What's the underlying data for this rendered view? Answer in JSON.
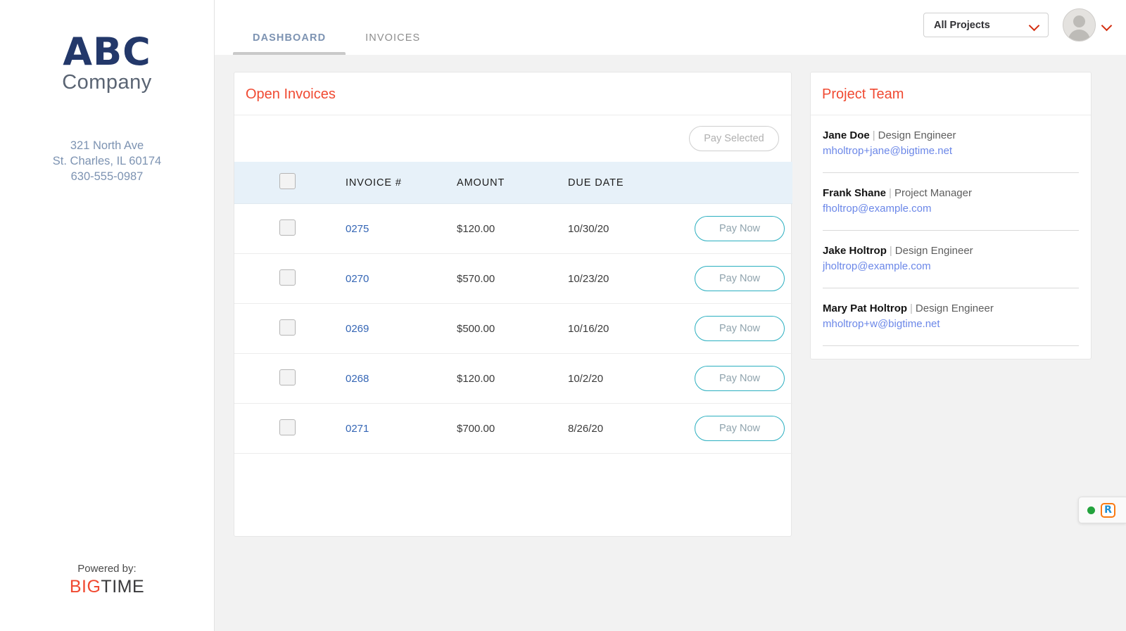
{
  "sidebar": {
    "logo_primary": "ABC",
    "logo_secondary": "Company",
    "address_line1": "321 North Ave",
    "address_line2": "St. Charles, IL 60174",
    "phone": "630-555-0987",
    "powered_label": "Powered by:",
    "powered_brand_first": "BIG",
    "powered_brand_second": "TIME"
  },
  "topbar": {
    "tabs": [
      {
        "label": "DASHBOARD",
        "active": true
      },
      {
        "label": "INVOICES",
        "active": false
      }
    ],
    "project_filter": {
      "selected": "All Projects",
      "icon": "chevron-down-icon"
    },
    "account_menu_icon": "chevron-down-icon",
    "avatar_icon": "user-avatar-icon"
  },
  "invoices_card": {
    "title": "Open Invoices",
    "pay_selected_label": "Pay Selected",
    "pay_selected_enabled": false,
    "columns": [
      "",
      "INVOICE #",
      "AMOUNT",
      "DUE DATE",
      ""
    ],
    "row_action_label": "Pay Now",
    "rows": [
      {
        "checked": false,
        "invoice": "0275",
        "amount": "$120.00",
        "due": "10/30/20",
        "action": "Pay Now"
      },
      {
        "checked": false,
        "invoice": "0270",
        "amount": "$570.00",
        "due": "10/23/20",
        "action": "Pay Now"
      },
      {
        "checked": false,
        "invoice": "0269",
        "amount": "$500.00",
        "due": "10/16/20",
        "action": "Pay Now"
      },
      {
        "checked": false,
        "invoice": "0268",
        "amount": "$120.00",
        "due": "10/2/20",
        "action": "Pay Now"
      },
      {
        "checked": false,
        "invoice": "0271",
        "amount": "$700.00",
        "due": "8/26/20",
        "action": "Pay Now"
      }
    ]
  },
  "team_card": {
    "title": "Project Team",
    "separator": "|",
    "members": [
      {
        "name": "Jane Doe",
        "role": "Design Engineer",
        "email": "mholtrop+jane@bigtime.net"
      },
      {
        "name": "Frank Shane",
        "role": "Project Manager",
        "email": "fholtrop@example.com"
      },
      {
        "name": "Jake Holtrop",
        "role": "Design Engineer",
        "email": "jholtrop@example.com"
      },
      {
        "name": "Mary Pat Holtrop",
        "role": "Design Engineer",
        "email": "mholtrop+w@bigtime.net"
      }
    ]
  },
  "chat_widget": {
    "status_icon": "green-status-dot-icon",
    "brand_icon": "r-logo-icon",
    "brand_letter": "R"
  },
  "colors": {
    "brand_red": "#f04a32",
    "logo_navy": "#23386a",
    "link_blue": "#3566b5",
    "email_blue": "#6b87e8",
    "teal": "#2bafc0",
    "tab_active": "#7d93b2",
    "header_row_bg": "#e7f1f9",
    "page_bg": "#f2f2f2"
  }
}
